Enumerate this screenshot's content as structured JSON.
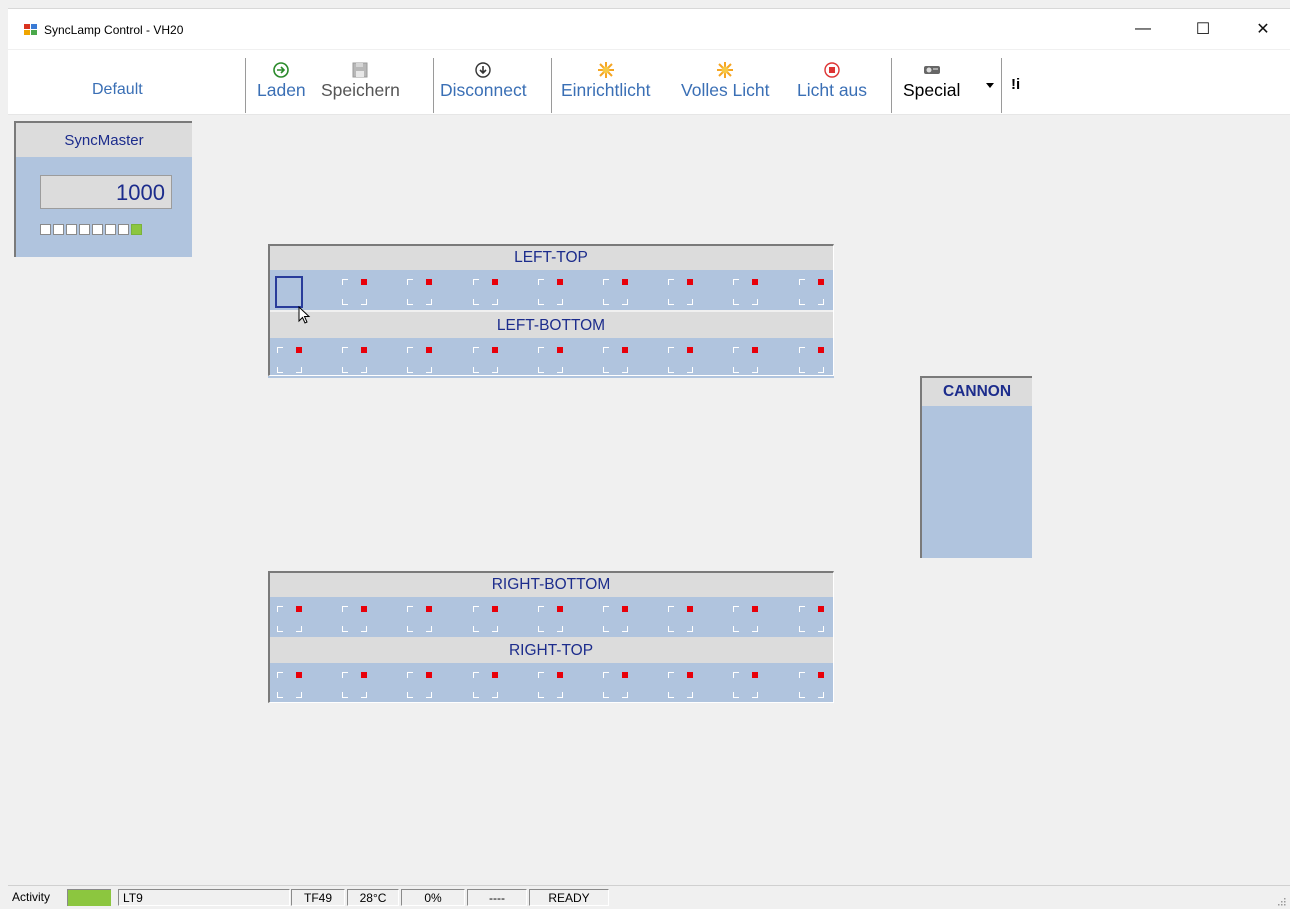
{
  "window": {
    "title": "SyncLamp Control - VH20",
    "minimize": "—",
    "maximize": "☐",
    "close": "✕"
  },
  "toolbar": {
    "profile": "Default",
    "load": "Laden",
    "save": "Speichern",
    "disconnect": "Disconnect",
    "setup_light": "Einrichtlicht",
    "full_light": "Volles Licht",
    "light_off": "Licht aus",
    "special": "Special",
    "info": "!i"
  },
  "syncmaster": {
    "title": "SyncMaster",
    "value": "1000",
    "leds": [
      false,
      false,
      false,
      false,
      false,
      false,
      false,
      true
    ]
  },
  "groups": [
    {
      "name": "LEFT-TOP",
      "lamps": 9,
      "selected_index": 0
    },
    {
      "name": "LEFT-BOTTOM",
      "lamps": 9
    },
    {
      "name": "RIGHT-BOTTOM",
      "lamps": 9
    },
    {
      "name": "RIGHT-TOP",
      "lamps": 9
    }
  ],
  "cannon": {
    "title": "CANNON"
  },
  "statusbar": {
    "activity_label": "Activity",
    "activity_color": "#8cc63f",
    "lt": "LT9",
    "tf": "TF49",
    "temp": "28°C",
    "percent": "0%",
    "dashes": "----",
    "state": "READY"
  },
  "colors": {
    "panel": "#b0c4de",
    "header": "#dcdcdc",
    "label": "#1c2c8c",
    "lamp_dot": "#e8000a",
    "toolbar_text": "#3a6fb5"
  }
}
